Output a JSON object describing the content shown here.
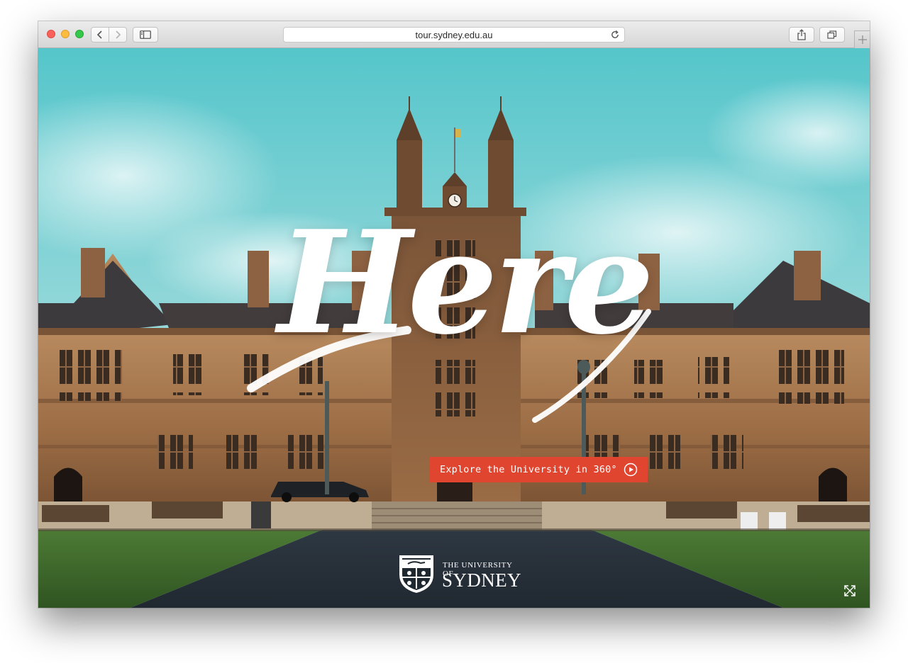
{
  "browser": {
    "url": "tour.sydney.edu.au",
    "icons": {
      "back": "chevron-left-icon",
      "forward": "chevron-right-icon",
      "sidebar": "sidebar-icon",
      "reload": "reload-icon",
      "share": "share-icon",
      "tabs": "tabs-overview-icon",
      "new_tab": "plus-icon"
    }
  },
  "hero": {
    "headline": "Here",
    "cta_label": "Explore the University in 360°",
    "cta_icon": "play-circle-icon",
    "fullscreen_icon": "expand-icon"
  },
  "brand": {
    "line1": "THE UNIVERSITY OF",
    "line2": "SYDNEY"
  },
  "colors": {
    "cta_background": "#e0452f",
    "sky": "#7fd0d4",
    "sandstone": "#a5744a"
  }
}
